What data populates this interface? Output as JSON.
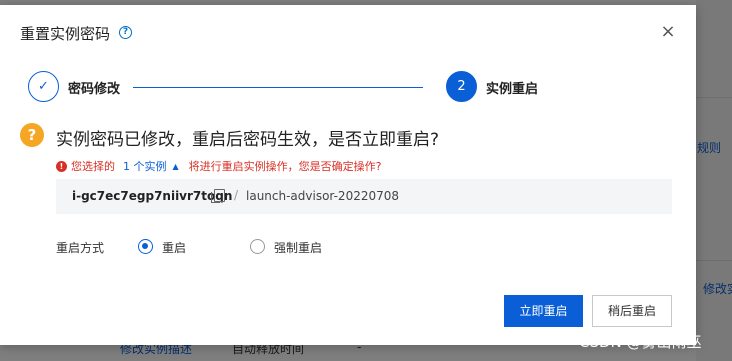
{
  "background": {
    "right_link_1": "规则",
    "right_link_2": "修改实",
    "bottom_link": "修改实例描述",
    "bottom_text": "自动释放时间",
    "bottom_dash": "-"
  },
  "dialog": {
    "title": "重置实例密码",
    "help_icon": "question-circle-icon",
    "close_icon": "close-icon",
    "close_glyph": "×",
    "steps": [
      {
        "number": "✓",
        "label": "密码修改",
        "status": "done"
      },
      {
        "number": "2",
        "label": "实例重启",
        "status": "active"
      }
    ],
    "question_icon_glyph": "?",
    "question": "实例密码已修改，重启后密码生效，是否立即重启?",
    "warning": {
      "icon_glyph": "!",
      "prefix": "您选择的",
      "instance_link": "1 个实例",
      "caret": "▲",
      "suffix": "将进行重启实例操作，您是否确定操作?"
    },
    "instance": {
      "id": "i-gc7ec7egp7niivr7toqn",
      "separator": "/",
      "name": "launch-advisor-20220708"
    },
    "restart_mode": {
      "label": "重启方式",
      "options": [
        {
          "label": "重启",
          "checked": true
        },
        {
          "label": "强制重启",
          "checked": false
        }
      ]
    },
    "buttons": {
      "confirm": "立即重启",
      "later": "稍后重启"
    }
  },
  "watermark": "CSDN @雾山雨巫",
  "colors": {
    "primary": "#0a5fd6",
    "warning": "#d93026",
    "question_icon": "#f5a623"
  }
}
